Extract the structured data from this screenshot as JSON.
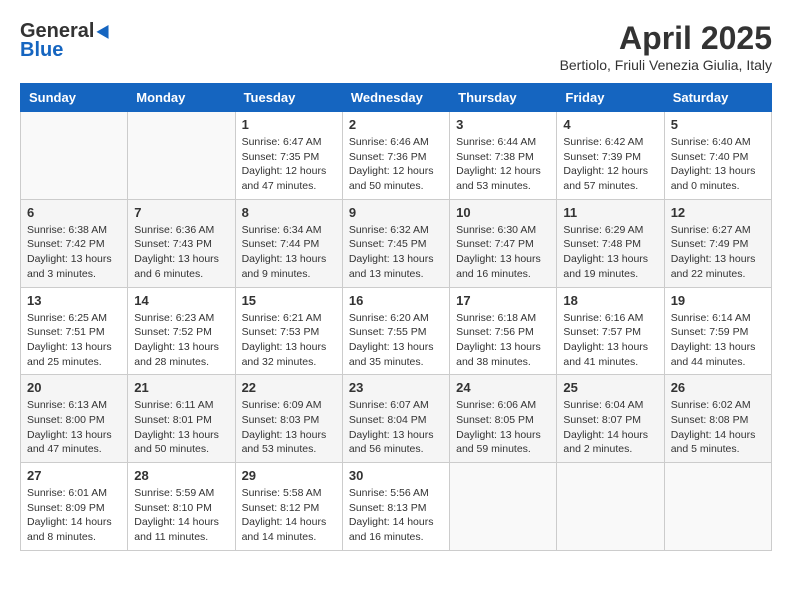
{
  "header": {
    "logo_general": "General",
    "logo_blue": "Blue",
    "title": "April 2025",
    "subtitle": "Bertiolo, Friuli Venezia Giulia, Italy"
  },
  "weekdays": [
    "Sunday",
    "Monday",
    "Tuesday",
    "Wednesday",
    "Thursday",
    "Friday",
    "Saturday"
  ],
  "weeks": [
    [
      {
        "day": "",
        "info": ""
      },
      {
        "day": "",
        "info": ""
      },
      {
        "day": "1",
        "info": "Sunrise: 6:47 AM\nSunset: 7:35 PM\nDaylight: 12 hours\nand 47 minutes."
      },
      {
        "day": "2",
        "info": "Sunrise: 6:46 AM\nSunset: 7:36 PM\nDaylight: 12 hours\nand 50 minutes."
      },
      {
        "day": "3",
        "info": "Sunrise: 6:44 AM\nSunset: 7:38 PM\nDaylight: 12 hours\nand 53 minutes."
      },
      {
        "day": "4",
        "info": "Sunrise: 6:42 AM\nSunset: 7:39 PM\nDaylight: 12 hours\nand 57 minutes."
      },
      {
        "day": "5",
        "info": "Sunrise: 6:40 AM\nSunset: 7:40 PM\nDaylight: 13 hours\nand 0 minutes."
      }
    ],
    [
      {
        "day": "6",
        "info": "Sunrise: 6:38 AM\nSunset: 7:42 PM\nDaylight: 13 hours\nand 3 minutes."
      },
      {
        "day": "7",
        "info": "Sunrise: 6:36 AM\nSunset: 7:43 PM\nDaylight: 13 hours\nand 6 minutes."
      },
      {
        "day": "8",
        "info": "Sunrise: 6:34 AM\nSunset: 7:44 PM\nDaylight: 13 hours\nand 9 minutes."
      },
      {
        "day": "9",
        "info": "Sunrise: 6:32 AM\nSunset: 7:45 PM\nDaylight: 13 hours\nand 13 minutes."
      },
      {
        "day": "10",
        "info": "Sunrise: 6:30 AM\nSunset: 7:47 PM\nDaylight: 13 hours\nand 16 minutes."
      },
      {
        "day": "11",
        "info": "Sunrise: 6:29 AM\nSunset: 7:48 PM\nDaylight: 13 hours\nand 19 minutes."
      },
      {
        "day": "12",
        "info": "Sunrise: 6:27 AM\nSunset: 7:49 PM\nDaylight: 13 hours\nand 22 minutes."
      }
    ],
    [
      {
        "day": "13",
        "info": "Sunrise: 6:25 AM\nSunset: 7:51 PM\nDaylight: 13 hours\nand 25 minutes."
      },
      {
        "day": "14",
        "info": "Sunrise: 6:23 AM\nSunset: 7:52 PM\nDaylight: 13 hours\nand 28 minutes."
      },
      {
        "day": "15",
        "info": "Sunrise: 6:21 AM\nSunset: 7:53 PM\nDaylight: 13 hours\nand 32 minutes."
      },
      {
        "day": "16",
        "info": "Sunrise: 6:20 AM\nSunset: 7:55 PM\nDaylight: 13 hours\nand 35 minutes."
      },
      {
        "day": "17",
        "info": "Sunrise: 6:18 AM\nSunset: 7:56 PM\nDaylight: 13 hours\nand 38 minutes."
      },
      {
        "day": "18",
        "info": "Sunrise: 6:16 AM\nSunset: 7:57 PM\nDaylight: 13 hours\nand 41 minutes."
      },
      {
        "day": "19",
        "info": "Sunrise: 6:14 AM\nSunset: 7:59 PM\nDaylight: 13 hours\nand 44 minutes."
      }
    ],
    [
      {
        "day": "20",
        "info": "Sunrise: 6:13 AM\nSunset: 8:00 PM\nDaylight: 13 hours\nand 47 minutes."
      },
      {
        "day": "21",
        "info": "Sunrise: 6:11 AM\nSunset: 8:01 PM\nDaylight: 13 hours\nand 50 minutes."
      },
      {
        "day": "22",
        "info": "Sunrise: 6:09 AM\nSunset: 8:03 PM\nDaylight: 13 hours\nand 53 minutes."
      },
      {
        "day": "23",
        "info": "Sunrise: 6:07 AM\nSunset: 8:04 PM\nDaylight: 13 hours\nand 56 minutes."
      },
      {
        "day": "24",
        "info": "Sunrise: 6:06 AM\nSunset: 8:05 PM\nDaylight: 13 hours\nand 59 minutes."
      },
      {
        "day": "25",
        "info": "Sunrise: 6:04 AM\nSunset: 8:07 PM\nDaylight: 14 hours\nand 2 minutes."
      },
      {
        "day": "26",
        "info": "Sunrise: 6:02 AM\nSunset: 8:08 PM\nDaylight: 14 hours\nand 5 minutes."
      }
    ],
    [
      {
        "day": "27",
        "info": "Sunrise: 6:01 AM\nSunset: 8:09 PM\nDaylight: 14 hours\nand 8 minutes."
      },
      {
        "day": "28",
        "info": "Sunrise: 5:59 AM\nSunset: 8:10 PM\nDaylight: 14 hours\nand 11 minutes."
      },
      {
        "day": "29",
        "info": "Sunrise: 5:58 AM\nSunset: 8:12 PM\nDaylight: 14 hours\nand 14 minutes."
      },
      {
        "day": "30",
        "info": "Sunrise: 5:56 AM\nSunset: 8:13 PM\nDaylight: 14 hours\nand 16 minutes."
      },
      {
        "day": "",
        "info": ""
      },
      {
        "day": "",
        "info": ""
      },
      {
        "day": "",
        "info": ""
      }
    ]
  ]
}
